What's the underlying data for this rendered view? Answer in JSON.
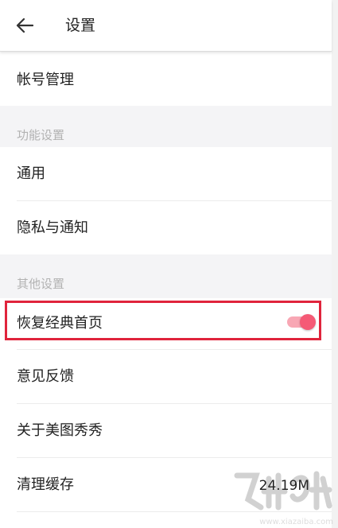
{
  "header": {
    "title": "设置",
    "back_icon": "arrow-left-icon"
  },
  "items": {
    "account": {
      "label": "帐号管理"
    },
    "general": {
      "label": "通用"
    },
    "privacy": {
      "label": "隐私与通知"
    },
    "classic_home": {
      "label": "恢复经典首页",
      "toggle_on": true
    },
    "feedback": {
      "label": "意见反馈"
    },
    "about": {
      "label": "关于美图秀秀"
    },
    "cache": {
      "label": "清理缓存",
      "value": "24.19M"
    }
  },
  "sections": {
    "function": {
      "label": "功能设置"
    },
    "other": {
      "label": "其他设置"
    }
  },
  "colors": {
    "accent": "#f55a76",
    "highlight_border": "#e0243c",
    "section_bg": "#f4f4f6"
  },
  "watermark": {
    "text": "www.xiazaiba.com"
  }
}
